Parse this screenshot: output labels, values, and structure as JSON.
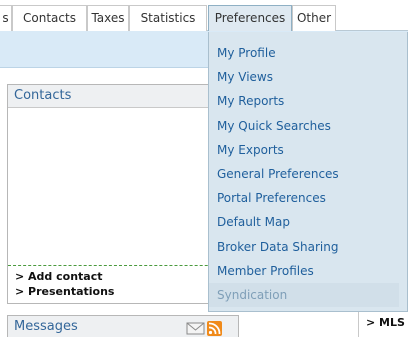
{
  "tabs": [
    "s",
    "Contacts",
    "Taxes",
    "Statistics",
    "Preferences",
    "Other"
  ],
  "active_tab": "Preferences",
  "contacts_panel": {
    "title": "Contacts",
    "links": [
      "> Add contact",
      "> Presentations"
    ]
  },
  "messages_panel": {
    "title": "Messages"
  },
  "right_label": "> MLS",
  "preferences_menu": {
    "items": [
      "My Profile",
      "My Views",
      "My Reports",
      "My Quick Searches",
      "My Exports",
      "General Preferences",
      "Portal Preferences",
      "Default Map",
      "Broker Data Sharing",
      "Member Profiles",
      "Syndication"
    ],
    "hovered_item": "Syndication"
  },
  "icons": [
    "envelope-icon",
    "rss-icon"
  ],
  "colors": {
    "link_blue": "#1f5f9c",
    "menu_bg": "#d9e6ef",
    "rss_orange": "#f08a1a",
    "header_blue": "#336699"
  }
}
